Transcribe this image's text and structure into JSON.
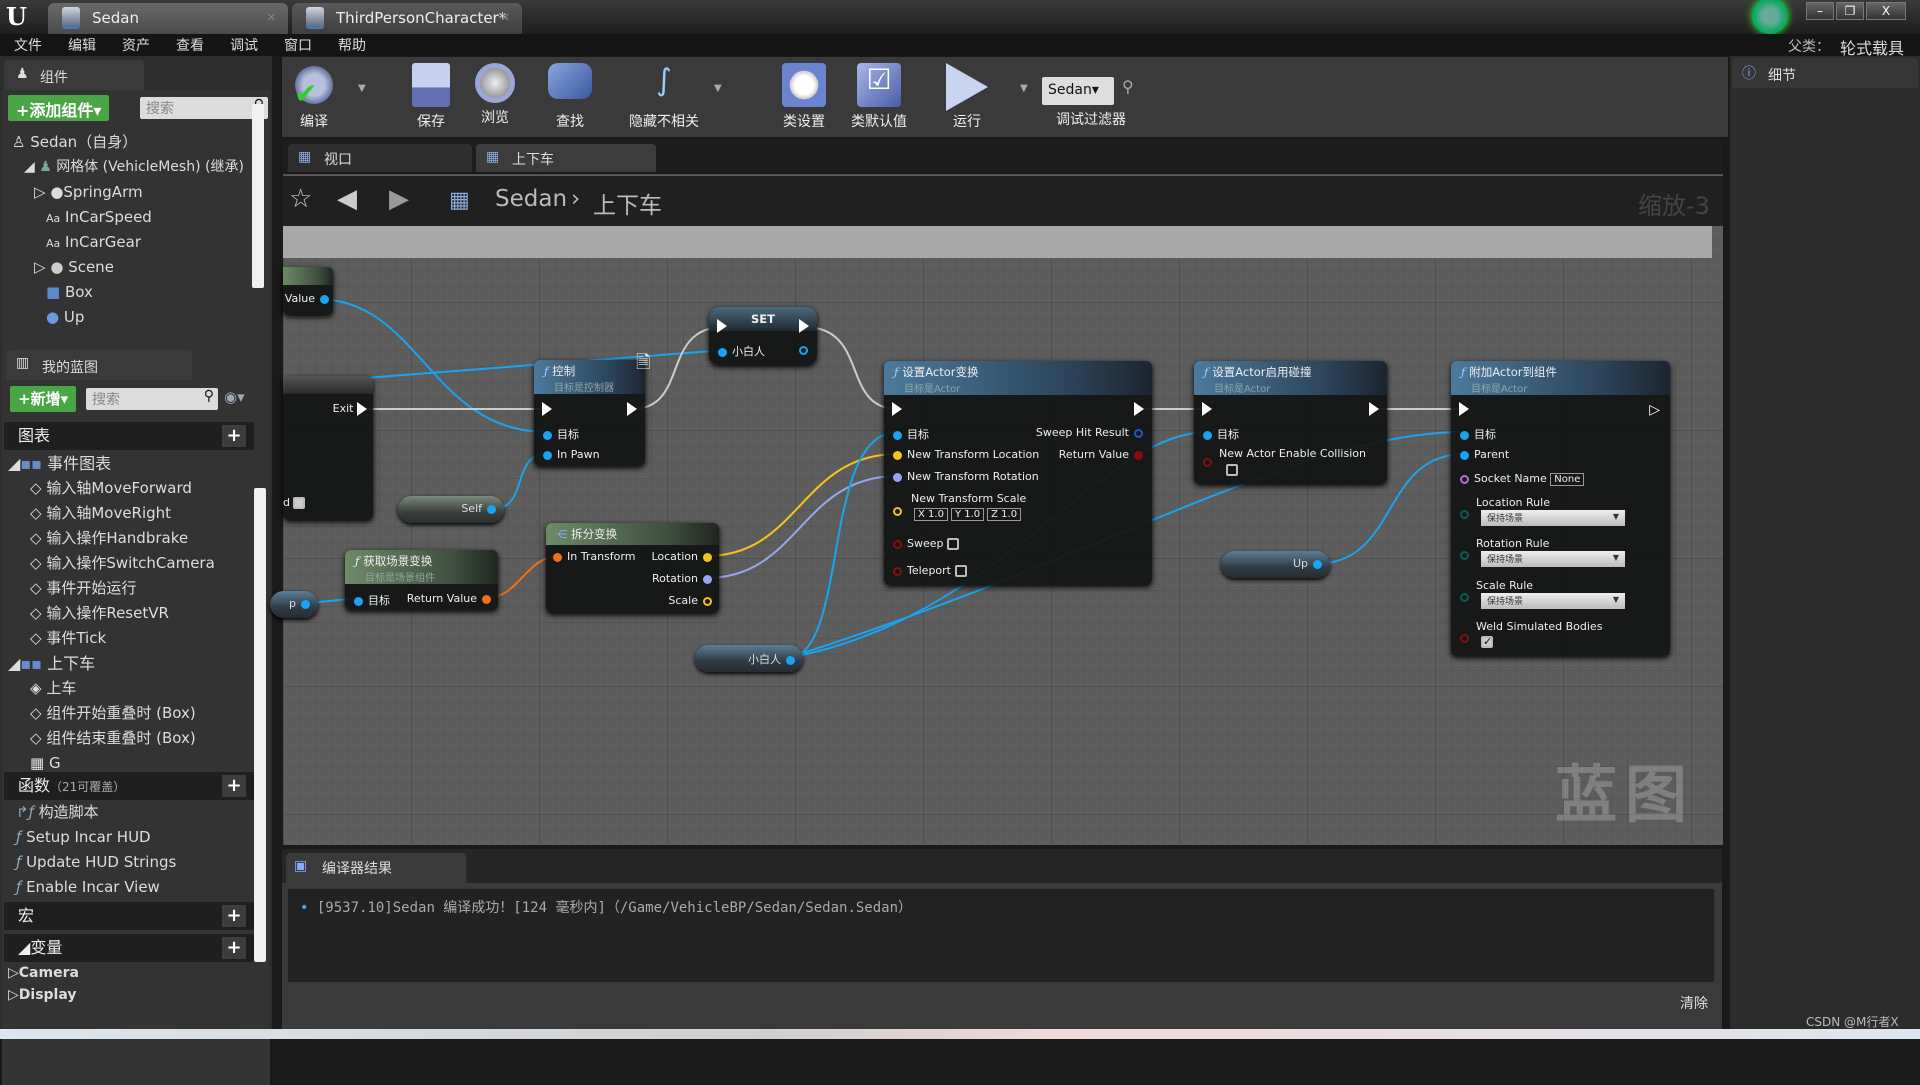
{
  "window": {
    "tabs": [
      {
        "label": "Sedan"
      },
      {
        "label": "ThirdPersonCharacter*"
      }
    ],
    "controls": [
      "–",
      "❐",
      "X"
    ]
  },
  "menu": [
    "文件",
    "编辑",
    "资产",
    "查看",
    "调试",
    "窗口",
    "帮助"
  ],
  "parent_class": {
    "label": "父类：",
    "value": "轮式载具"
  },
  "components": {
    "tab": "组件",
    "add_button": "+添加组件▾",
    "search_placeholder": "搜索",
    "items": [
      {
        "label": "Sedan（自身）"
      },
      {
        "label": "网格体 (VehicleMesh) (继承)"
      },
      {
        "label": "SpringArm"
      },
      {
        "label": "InCarSpeed"
      },
      {
        "label": "InCarGear"
      },
      {
        "label": "Scene"
      },
      {
        "label": "Box"
      },
      {
        "label": "Up"
      }
    ]
  },
  "my_blueprint": {
    "tab": "我的蓝图",
    "new_button": "+新增▾",
    "search_placeholder": "搜索",
    "graphs_label": "图表",
    "event_graph": "事件图表",
    "event_items": [
      "输入轴MoveForward",
      "输入轴MoveRight",
      "输入操作Handbrake",
      "输入操作SwitchCamera",
      "事件开始运行",
      "输入操作ResetVR",
      "事件Tick"
    ],
    "graph2": "上下车",
    "graph2_items": [
      "上车",
      "组件开始重叠时 (Box)",
      "组件结束重叠时 (Box)",
      "G"
    ],
    "functions_label": "函数",
    "functions_note": "（21可覆盖）",
    "functions": [
      "构造脚本",
      "Setup Incar HUD",
      "Update HUD Strings",
      "Enable Incar View"
    ],
    "macros_label": "宏",
    "variables_label": "变量",
    "variable_groups": [
      "Camera",
      "Display"
    ]
  },
  "toolbar": {
    "buttons": [
      {
        "label": "编译"
      },
      {
        "label": "保存"
      },
      {
        "label": "浏览"
      },
      {
        "label": "查找"
      },
      {
        "label": "隐藏不相关"
      },
      {
        "label": "类设置"
      },
      {
        "label": "类默认值"
      },
      {
        "label": "运行"
      }
    ],
    "debug_selector": "Sedan▾",
    "debug_filter": "调试过滤器"
  },
  "details": {
    "tab": "细节"
  },
  "graph_tabs": [
    {
      "label": "视口"
    },
    {
      "label": "上下车"
    }
  ],
  "breadcrumb": {
    "root": "Sedan",
    "separator": "›",
    "current": "上下车",
    "zoom": "缩放-3"
  },
  "watermark": "蓝图",
  "nodes": {
    "value_node": {
      "pin": "Value"
    },
    "exit_node": {
      "exit": "Exit",
      "bottom_label": "d"
    },
    "control": {
      "title": "控制",
      "subtitle": "目标是控制器",
      "pins": [
        "目标",
        "In Pawn"
      ]
    },
    "set": {
      "title": "SET",
      "pin": "小白人"
    },
    "self": {
      "label": "Self"
    },
    "get_world_transform": {
      "title": "获取场景变换",
      "subtitle": "目标是场景组件",
      "in": "目标",
      "out": "Return Value"
    },
    "p_var": {
      "label": "p"
    },
    "break_transform": {
      "title": "拆分变换",
      "in": "In Transform",
      "outs": [
        "Location",
        "Rotation",
        "Scale"
      ]
    },
    "xiaobairen_var": {
      "label": "小白人"
    },
    "set_actor_transform": {
      "title": "设置Actor变换",
      "subtitle": "目标是Actor",
      "pins": [
        "目标",
        "New Transform Location",
        "New Transform Rotation",
        "New Transform Scale",
        "Sweep",
        "Teleport"
      ],
      "outs": [
        "Sweep Hit Result",
        "Return Value"
      ],
      "scale": {
        "x": "1.0",
        "y": "1.0",
        "z": "1.0"
      },
      "sweep": false,
      "teleport": false
    },
    "set_actor_collision": {
      "title": "设置Actor启用碰撞",
      "subtitle": "目标是Actor",
      "pins": [
        "目标",
        "New Actor Enable Collision"
      ],
      "enable": false
    },
    "up_var": {
      "label": "Up"
    },
    "attach_actor": {
      "title": "附加Actor到组件",
      "subtitle": "目标是Actor",
      "pins": [
        "目标",
        "Parent",
        "Socket Name",
        "Location Rule",
        "Rotation Rule",
        "Scale Rule",
        "Weld Simulated Bodies"
      ],
      "socket": "None",
      "location_rule": "保持场景",
      "rotation_rule": "保持场景",
      "scale_rule": "保持场景",
      "weld": true
    }
  },
  "compiler": {
    "tab": "编译器结果",
    "log": "[9537.10]Sedan 编译成功！[124 毫秒内]（/Game/VehicleBP/Sedan/Sedan.Sedan）",
    "clear": "清除"
  },
  "credit": "CSDN @M行者X",
  "colors": {
    "exec": "#ffffff",
    "object_pin": "#1aa3f0",
    "vector_pin": "#f5c31b",
    "rotator_pin": "#9aa5f0",
    "transform_pin": "#f07014",
    "bool_pin": "#8a0d0d",
    "name_pin": "#b56ee0",
    "enum_pin": "#0b5c55",
    "green_button": "#4aa545"
  }
}
